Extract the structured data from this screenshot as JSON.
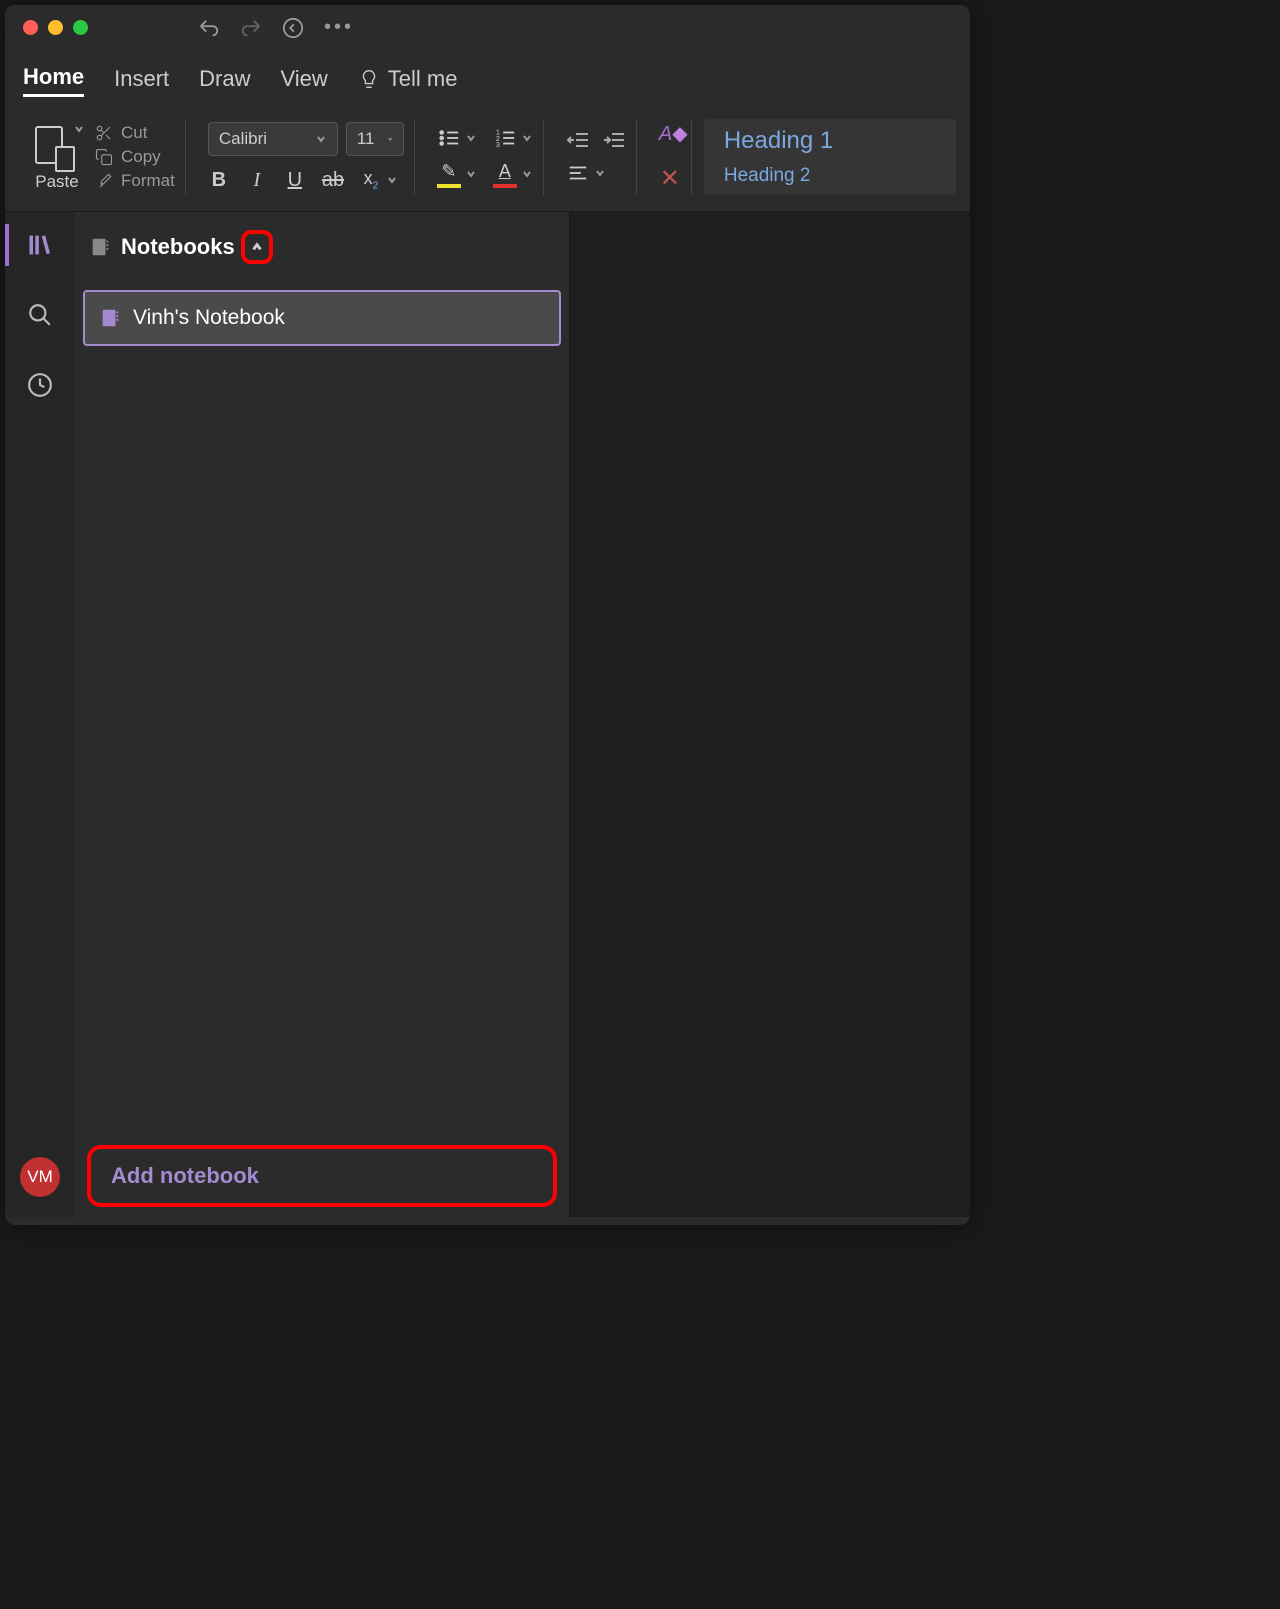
{
  "menu": {
    "home": "Home",
    "insert": "Insert",
    "draw": "Draw",
    "view": "View",
    "tellme": "Tell me"
  },
  "ribbon": {
    "paste": "Paste",
    "cut": "Cut",
    "copy": "Copy",
    "format": "Format",
    "font_name": "Calibri",
    "font_size": "11"
  },
  "styles": {
    "heading1": "Heading 1",
    "heading2": "Heading 2"
  },
  "sidebar": {
    "header": "Notebooks",
    "notebooks": [
      {
        "name": "Vinh's Notebook"
      }
    ],
    "add_label": "Add notebook"
  },
  "user": {
    "initials": "VM"
  }
}
